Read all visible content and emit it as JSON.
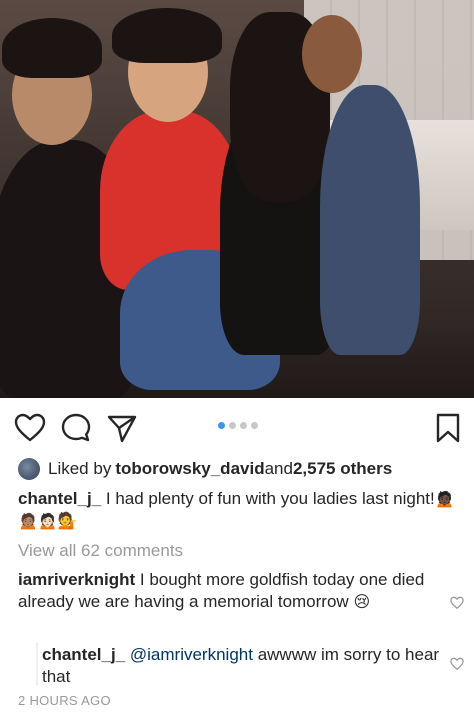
{
  "post": {
    "carousel_position": 1,
    "carousel_count": 4
  },
  "likes": {
    "prefix": "Liked by ",
    "user": "toborowsky_david",
    "and": " and ",
    "count": "2,575 others"
  },
  "caption": {
    "author": "chantel_j_",
    "text": " I had plenty of fun with you ladies last night!",
    "emojis": "🙍🏿🙍🏽🙍🏻💁"
  },
  "view_all_comments": "View all 62 comments",
  "comments": [
    {
      "author": "iamriverknight",
      "text": " I bought more goldfish today one died already we are having a memorial tomorrow",
      "emoji": "😢"
    }
  ],
  "reply": {
    "author": "chantel_j_",
    "mention": "@iamriverknight",
    "text": " awwww im sorry to hear that"
  },
  "timestamp": "2 HOURS AGO",
  "colors": {
    "accent": "#3897f0",
    "text": "#262626",
    "muted": "#999999",
    "mention": "#003569"
  },
  "icons": [
    "heart-icon",
    "comment-icon",
    "share-icon",
    "bookmark-icon"
  ]
}
